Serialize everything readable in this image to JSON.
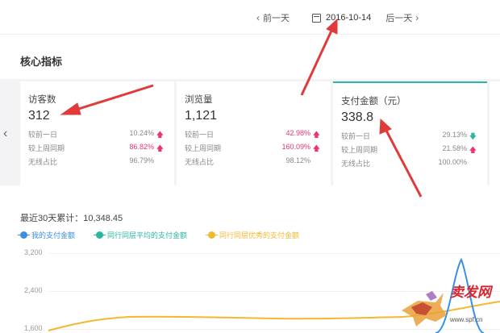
{
  "topnav": {
    "prev_label": "前一天",
    "date": "2016-10-14",
    "next_label": "后一天",
    "icon_prev": "chevron-left-icon",
    "icon_calendar": "calendar-icon",
    "icon_next": "chevron-right-icon"
  },
  "section": {
    "title": "核心指标"
  },
  "cards": [
    {
      "title": "访客数",
      "value": "312",
      "rows": [
        {
          "label": "较前一日",
          "value": "10.24%",
          "trend": "up",
          "value_color": "gray"
        },
        {
          "label": "较上周同期",
          "value": "86.82%",
          "trend": "up",
          "value_color": "red"
        },
        {
          "label": "无线占比",
          "value": "96.79%",
          "trend": "",
          "value_color": "gray"
        }
      ]
    },
    {
      "title": "浏览量",
      "value": "1,121",
      "rows": [
        {
          "label": "较前一日",
          "value": "42.98%",
          "trend": "up",
          "value_color": "red"
        },
        {
          "label": "较上周同期",
          "value": "160.09%",
          "trend": "up",
          "value_color": "red"
        },
        {
          "label": "无线占比",
          "value": "98.12%",
          "trend": "",
          "value_color": "gray"
        }
      ]
    },
    {
      "title": "支付金额（元）",
      "value": "338.8",
      "rows": [
        {
          "label": "较前一日",
          "value": "29.13%",
          "trend": "down",
          "value_color": "gray"
        },
        {
          "label": "较上周同期",
          "value": "21.58%",
          "trend": "up",
          "value_color": "gray"
        },
        {
          "label": "无线占比",
          "value": "100.00%",
          "trend": "",
          "value_color": "gray"
        }
      ]
    }
  ],
  "summary": {
    "text": "最近30天累计：10,348.45"
  },
  "legend": [
    {
      "label": "我的支付金额",
      "color": "#3a8ee6"
    },
    {
      "label": "同行同层平均的支付金额",
      "color": "#2bb5a3"
    },
    {
      "label": "同行同层优秀的支付金额",
      "color": "#f2b830"
    }
  ],
  "y_ticks": [
    "3,200",
    "2,400",
    "1,600"
  ],
  "watermark": {
    "text": "卖发网",
    "url": "www.spf.cn"
  },
  "colors": {
    "accent": "#2bb5a3",
    "arrow": "#e03a3a",
    "up": "#e8366f",
    "down": "#2bb5a3"
  }
}
